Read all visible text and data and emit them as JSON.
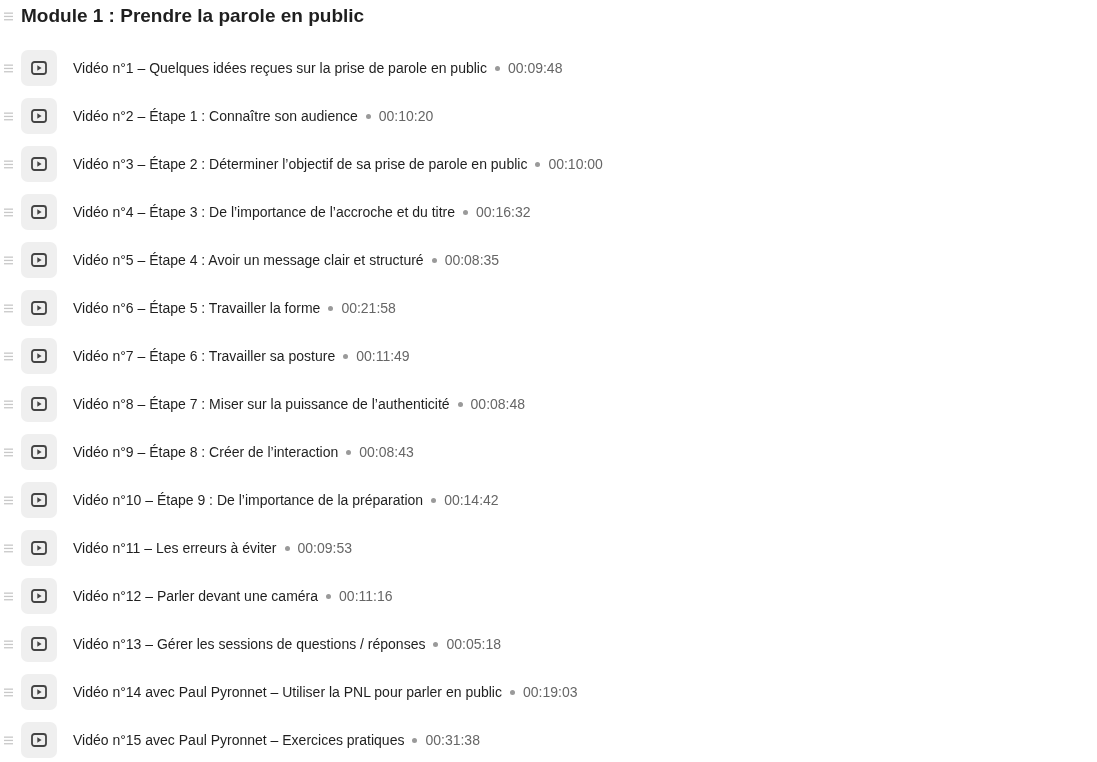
{
  "module": {
    "title": "Module 1 : Prendre la parole en public"
  },
  "lessons": [
    {
      "title": "Vidéo n°1 – Quelques idées reçues sur la prise de parole en public",
      "duration": "00:09:48"
    },
    {
      "title": "Vidéo n°2 – Étape 1 : Connaître son audience",
      "duration": "00:10:20"
    },
    {
      "title": "Vidéo n°3 – Étape 2 : Déterminer l’objectif de sa prise de parole en public",
      "duration": "00:10:00"
    },
    {
      "title": "Vidéo n°4 – Étape 3 : De l’importance de l’accroche et du titre",
      "duration": "00:16:32"
    },
    {
      "title": "Vidéo n°5 – Étape 4 : Avoir un message clair et structuré",
      "duration": "00:08:35"
    },
    {
      "title": "Vidéo n°6 – Étape 5 : Travailler la forme",
      "duration": "00:21:58"
    },
    {
      "title": "Vidéo n°7 – Étape 6 : Travailler sa posture",
      "duration": "00:11:49"
    },
    {
      "title": "Vidéo n°8 – Étape 7 : Miser sur la puissance de l’authenticité",
      "duration": "00:08:48"
    },
    {
      "title": "Vidéo n°9 – Étape 8 : Créer de l’interaction",
      "duration": "00:08:43"
    },
    {
      "title": "Vidéo n°10 – Étape 9 : De l’importance de la préparation",
      "duration": "00:14:42"
    },
    {
      "title": "Vidéo n°11 – Les erreurs à éviter",
      "duration": "00:09:53"
    },
    {
      "title": "Vidéo n°12 – Parler devant une caméra",
      "duration": "00:11:16"
    },
    {
      "title": "Vidéo n°13 – Gérer les sessions de questions / réponses",
      "duration": "00:05:18"
    },
    {
      "title": "Vidéo n°14 avec Paul Pyronnet – Utiliser la PNL pour parler en public",
      "duration": "00:19:03"
    },
    {
      "title": "Vidéo n°15 avec Paul Pyronnet – Exercices pratiques",
      "duration": "00:31:38"
    }
  ]
}
